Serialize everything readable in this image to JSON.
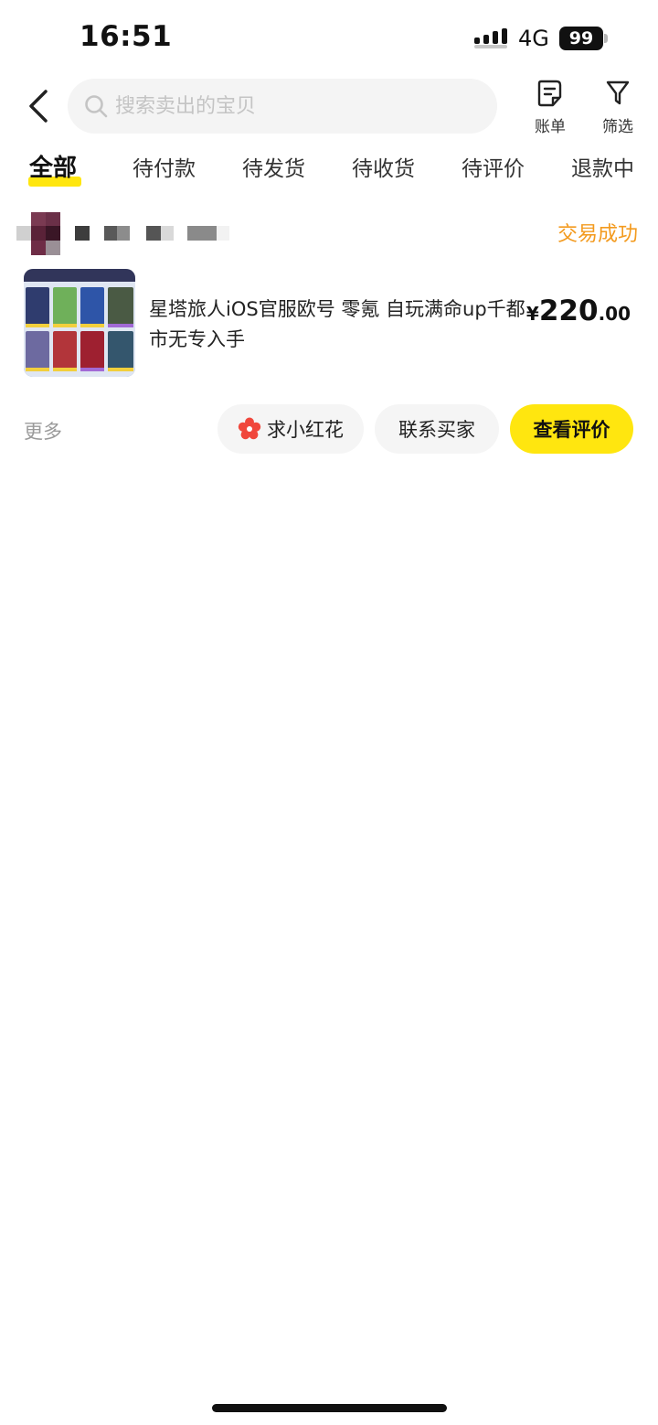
{
  "status_bar": {
    "time": "16:51",
    "network": "4G",
    "battery": "99"
  },
  "header": {
    "search_placeholder": "搜索卖出的宝贝",
    "bill_label": "账单",
    "filter_label": "筛选"
  },
  "tabs": [
    {
      "label": "全部",
      "active": true
    },
    {
      "label": "待付款"
    },
    {
      "label": "待发货"
    },
    {
      "label": "待收货"
    },
    {
      "label": "待评价"
    },
    {
      "label": "退款中"
    }
  ],
  "order": {
    "status": "交易成功",
    "title": "星塔旅人iOS官服欧号 零氪 自玩满命up千都市无专入手",
    "price": {
      "currency": "¥",
      "integer": "220",
      "decimal": ".00"
    },
    "more_label": "更多",
    "actions": {
      "flower": "求小红花",
      "contact": "联系买家",
      "review": "查看评价"
    }
  },
  "colors": {
    "accent": "#ffe60f",
    "status_text": "#f39a1e",
    "flower": "#f0473c"
  }
}
